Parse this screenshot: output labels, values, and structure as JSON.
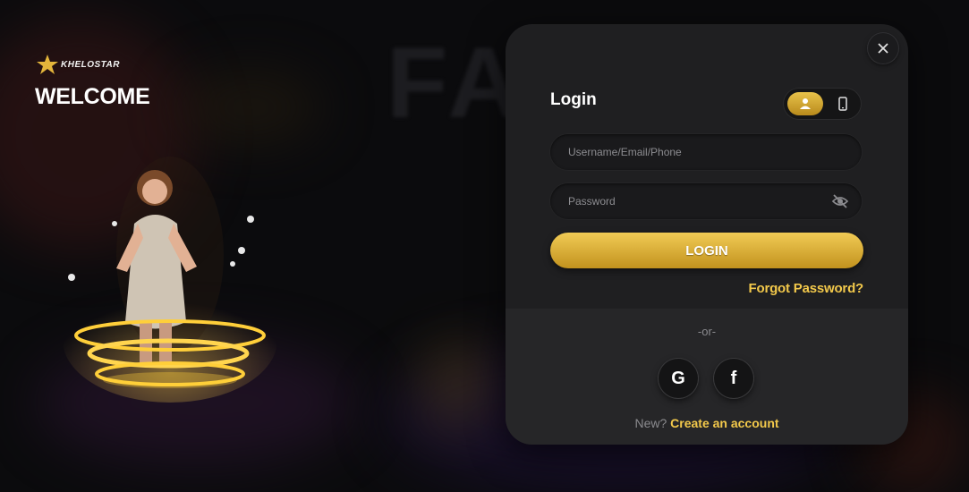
{
  "background": {
    "headline": "FASTEST"
  },
  "brand": {
    "logo_text": "KHELOSTAR",
    "welcome": "WELCOME",
    "accent_color": "#f3c94b"
  },
  "login": {
    "title": "Login",
    "mode_user_icon": "user-icon",
    "mode_phone_icon": "phone-icon",
    "username_placeholder": "Username/Email/Phone",
    "password_placeholder": "Password",
    "password_toggle_icon": "eye-slash-icon",
    "submit_label": "LOGIN",
    "forgot_label": "Forgot Password?",
    "divider": "-or-",
    "social": [
      "G",
      "f"
    ],
    "signup_prompt": "New?",
    "signup_link": "Create an account"
  }
}
